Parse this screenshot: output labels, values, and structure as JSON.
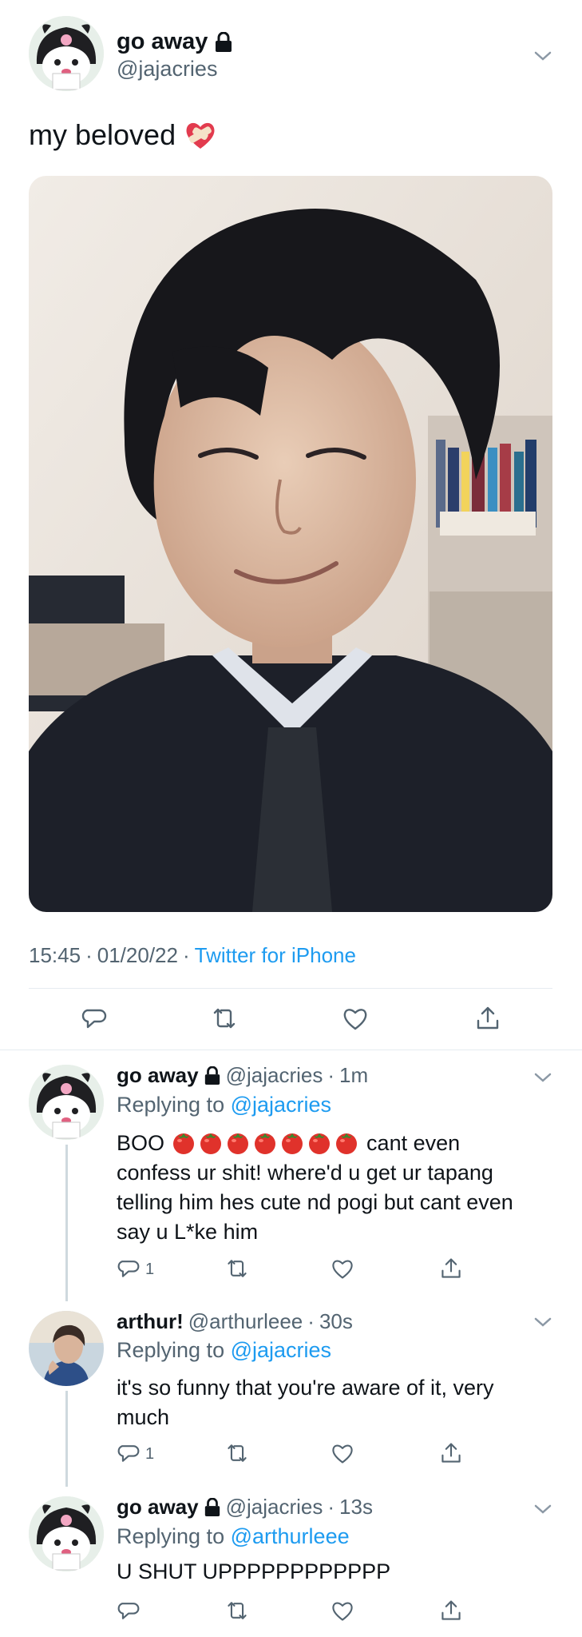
{
  "colors": {
    "link": "#1d9bf0",
    "muted": "#536471",
    "divider": "#e6ecf0",
    "thread": "#cfd9de"
  },
  "tweet": {
    "author_name": "go away",
    "author_handle": "@jajacries",
    "text": "my beloved",
    "emoji": "heart-with-bandage",
    "meta": {
      "time": "15:45",
      "sep1": "·",
      "date": "01/20/22",
      "sep2": "·",
      "source": "Twitter for iPhone"
    },
    "actions": [
      "reply-icon",
      "retweet-icon",
      "like-icon",
      "share-icon"
    ]
  },
  "replies": [
    {
      "name": "go away",
      "handle": "@jajacries",
      "sep": "·",
      "time": "1m",
      "replying_label": "Replying to",
      "replying_to": "@jajacries",
      "text_prefix": "BOO",
      "text_emoji_count": 7,
      "text_line1_tail": "cant even",
      "text_line2": "confess ur shit! where'd u get ur tapang",
      "text_line3": "telling him hes cute nd pogi but cant even",
      "text_line4": "say u L*ke him",
      "reply_count": "1"
    },
    {
      "name": "arthur!",
      "handle": "@arthurleee",
      "sep": "·",
      "time": "30s",
      "replying_label": "Replying to",
      "replying_to": "@jajacries",
      "text_line1": "it's so funny that you're aware of it, very",
      "text_line2": "much",
      "reply_count": "1"
    },
    {
      "name": "go away",
      "handle": "@jajacries",
      "sep": "·",
      "time": "13s",
      "replying_label": "Replying to",
      "replying_to": "@arthurleee",
      "text_line1": "U SHUT UPPPPPPPPPPPP"
    }
  ]
}
